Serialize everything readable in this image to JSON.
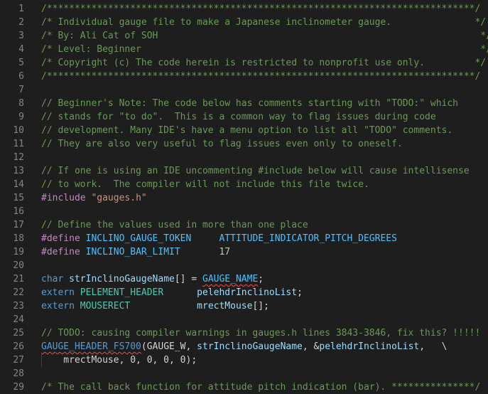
{
  "editor": {
    "lines": [
      {
        "n": "1",
        "tokens": [
          {
            "t": "/*****************************************************************************/",
            "c": "c"
          }
        ]
      },
      {
        "n": "2",
        "tokens": [
          {
            "t": "/* Individual gauge file to make a Japanese inclinometer gauge.               */",
            "c": "c"
          }
        ]
      },
      {
        "n": "3",
        "tokens": [
          {
            "t": "/* By: Ali Cat of SOH                                                          */",
            "c": "c"
          }
        ]
      },
      {
        "n": "4",
        "tokens": [
          {
            "t": "/* Level: Beginner                                                             */",
            "c": "c"
          }
        ]
      },
      {
        "n": "5",
        "tokens": [
          {
            "t": "/* Copyright (c) The code herein is restricted to nonprofit use only.         */",
            "c": "c"
          }
        ]
      },
      {
        "n": "6",
        "tokens": [
          {
            "t": "/*****************************************************************************/",
            "c": "c"
          }
        ]
      },
      {
        "n": "7",
        "tokens": []
      },
      {
        "n": "8",
        "tokens": [
          {
            "t": "// Beginner's Note: The code below has comments starting with \"TODO:\" which",
            "c": "c"
          }
        ]
      },
      {
        "n": "9",
        "tokens": [
          {
            "t": "// stands for \"to do\".  This is a common way to flag issues during code",
            "c": "c"
          }
        ]
      },
      {
        "n": "10",
        "tokens": [
          {
            "t": "// development. Many IDE's have a menu option to list all \"TODO\" comments.",
            "c": "c"
          }
        ]
      },
      {
        "n": "11",
        "tokens": [
          {
            "t": "// They are also very useful to flag issues even only to oneself.",
            "c": "c"
          }
        ]
      },
      {
        "n": "12",
        "tokens": []
      },
      {
        "n": "13",
        "tokens": [
          {
            "t": "// If one is using an IDE uncommenting #include below will cause intellisense",
            "c": "c"
          }
        ]
      },
      {
        "n": "14",
        "tokens": [
          {
            "t": "// to work.  The compiler will not include this file twice.",
            "c": "c"
          }
        ]
      },
      {
        "n": "15",
        "tokens": [
          {
            "t": "#include ",
            "c": "pp"
          },
          {
            "t": "\"gauges.h\"",
            "c": "str"
          }
        ]
      },
      {
        "n": "16",
        "tokens": []
      },
      {
        "n": "17",
        "tokens": [
          {
            "t": "// Define the values used in more than one place",
            "c": "c"
          }
        ]
      },
      {
        "n": "18",
        "tokens": [
          {
            "t": "#define ",
            "c": "pp"
          },
          {
            "t": "INCLINO_GAUGE_TOKEN",
            "c": "mac"
          },
          {
            "t": "     ",
            "c": "pl"
          },
          {
            "t": "ATTITUDE_INDICATOR_PITCH_DEGREES",
            "c": "mac"
          }
        ]
      },
      {
        "n": "19",
        "tokens": [
          {
            "t": "#define ",
            "c": "pp"
          },
          {
            "t": "INCLINO_BAR_LIMIT",
            "c": "mac"
          },
          {
            "t": "       ",
            "c": "pl"
          },
          {
            "t": "17",
            "c": "num"
          }
        ]
      },
      {
        "n": "20",
        "tokens": []
      },
      {
        "n": "21",
        "tokens": [
          {
            "t": "char ",
            "c": "kw"
          },
          {
            "t": "strInclinoGaugeName",
            "c": "var"
          },
          {
            "t": "[] = ",
            "c": "pl"
          },
          {
            "t": "GAUGE_NAME",
            "c": "mac",
            "s": true
          },
          {
            "t": ";",
            "c": "pl"
          }
        ]
      },
      {
        "n": "22",
        "tokens": [
          {
            "t": "extern ",
            "c": "kw"
          },
          {
            "t": "PELEMENT_HEADER",
            "c": "ty"
          },
          {
            "t": "      ",
            "c": "pl"
          },
          {
            "t": "pelehdrInclinoList",
            "c": "var"
          },
          {
            "t": ";",
            "c": "pl"
          }
        ]
      },
      {
        "n": "23",
        "tokens": [
          {
            "t": "extern ",
            "c": "kw"
          },
          {
            "t": "MOUSERECT",
            "c": "ty"
          },
          {
            "t": "            ",
            "c": "pl"
          },
          {
            "t": "mrectMouse",
            "c": "var"
          },
          {
            "t": "[];",
            "c": "pl"
          }
        ]
      },
      {
        "n": "24",
        "tokens": []
      },
      {
        "n": "25",
        "tokens": [
          {
            "t": "// TODO: causing compiler warnings in gauges.h lines 3843-3846, fix this? !!!!!",
            "c": "c"
          }
        ]
      },
      {
        "n": "26",
        "tokens": [
          {
            "t": "GAUGE_HEADER_FS700",
            "c": "fn",
            "s": true
          },
          {
            "t": "(GAUGE_W, ",
            "c": "pl"
          },
          {
            "t": "strInclinoGaugeName",
            "c": "var"
          },
          {
            "t": ", &",
            "c": "pl"
          },
          {
            "t": "pelehdrInclinoList",
            "c": "var"
          },
          {
            "t": ",   \\",
            "c": "pl"
          }
        ]
      },
      {
        "n": "27",
        "tokens": [
          {
            "t": "    mrectMouse, 0, 0, 0, 0);",
            "c": "pl"
          }
        ]
      },
      {
        "n": "28",
        "tokens": []
      },
      {
        "n": "29",
        "tokens": [
          {
            "t": "/* The call back function for attitude pitch indication (bar). ***************/",
            "c": "c"
          }
        ]
      }
    ]
  }
}
